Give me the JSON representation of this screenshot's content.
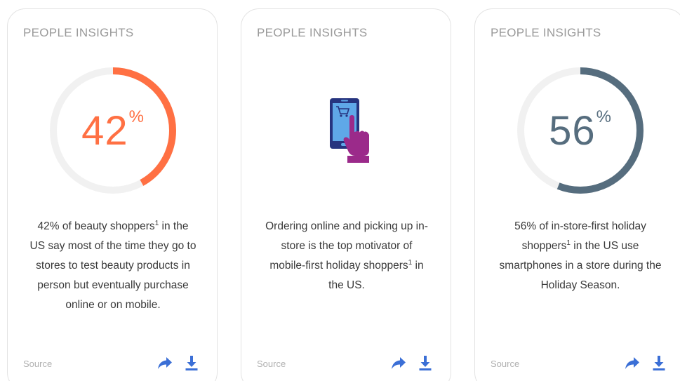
{
  "colors": {
    "accent_orange": "#ff7043",
    "accent_slate": "#566d7e",
    "ring_track": "#f1f1f1",
    "icon_blue": "#3b6fd6",
    "phone_navy": "#26347f",
    "phone_screen": "#5fa8e8",
    "hand_magenta": "#9b2a8a"
  },
  "cards": [
    {
      "eyebrow": "PEOPLE INSIGHTS",
      "stat": {
        "number": "42",
        "unit": "%",
        "fraction": 0.42
      },
      "description": {
        "pre": "42% of beauty shoppers",
        "sup": "1",
        "post": " in the US say most of the time they go to stores to test beauty products in person but eventually purchase online or on mobile."
      },
      "source": "Source",
      "icons": {
        "share": "share-arrow-icon",
        "download": "download-icon"
      }
    },
    {
      "eyebrow": "PEOPLE INSIGHTS",
      "visual_icon": "mobile-shopping-cart-hand-icon",
      "description": {
        "pre": "Ordering online and picking up in-store is the top motivator of mobile-first holiday shoppers",
        "sup": "1",
        "post": " in the US."
      },
      "source": "Source",
      "icons": {
        "share": "share-arrow-icon",
        "download": "download-icon"
      }
    },
    {
      "eyebrow": "PEOPLE INSIGHTS",
      "stat": {
        "number": "56",
        "unit": "%",
        "fraction": 0.56
      },
      "description": {
        "pre": "56% of in-store-first holiday shoppers",
        "sup": "1",
        "post": " in the US use smartphones in a store during the Holiday Season."
      },
      "source": "Source",
      "icons": {
        "share": "share-arrow-icon",
        "download": "download-icon"
      }
    }
  ]
}
